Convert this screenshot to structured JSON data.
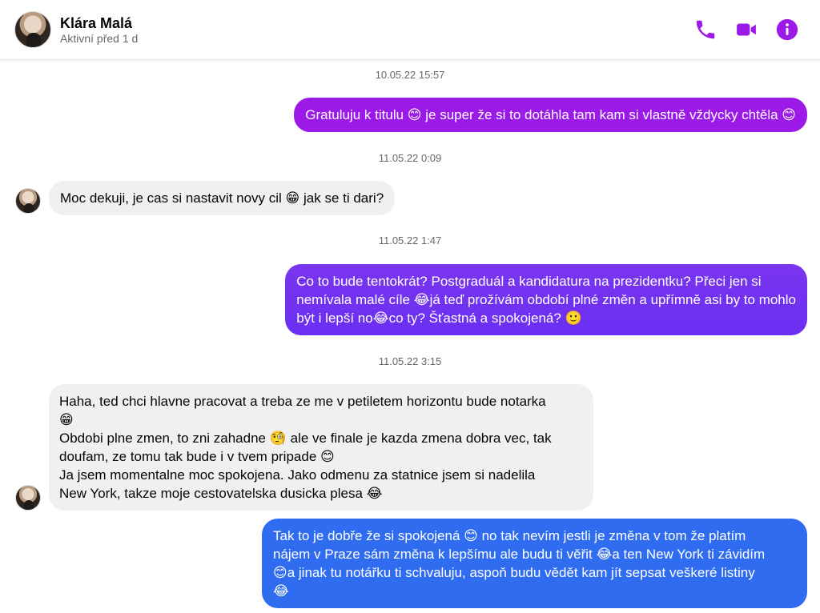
{
  "contact": {
    "name": "Klára Malá",
    "status": "Aktivní před 1 d"
  },
  "header_icons": [
    "phone-icon",
    "video-icon",
    "info-icon"
  ],
  "colors": {
    "accent": "#9b1ae8",
    "outgoing_1": "#9b1ae8",
    "outgoing_2": "#6a2ff2",
    "outgoing_3": "#2f6cf0",
    "incoming": "#f0f0f0"
  },
  "messages": [
    {
      "timestamp": "10.05.22 15:57"
    },
    {
      "direction": "outgoing",
      "lines": [
        "Gratuluju k titulu 😊 je super že si to dotáhla tam kam si vlastně vždycky chtěla 😊"
      ]
    },
    {
      "timestamp": "11.05.22 0:09"
    },
    {
      "direction": "incoming",
      "lines": [
        "Moc dekuji, je cas si nastavit novy cil 😁 jak se ti dari?"
      ]
    },
    {
      "timestamp": "11.05.22 1:47"
    },
    {
      "direction": "outgoing",
      "lines": [
        "Co to bude tentokrát? Postgraduál a kandidatura na prezidentku? Přeci jen si",
        "nemívala malé cíle 😂já teď  prožívám období plné změn a upřímně asi by to mohlo",
        "být i lepší no😂co ty? Šťastná a spokojená? 🙂"
      ]
    },
    {
      "timestamp": "11.05.22 3:15"
    },
    {
      "direction": "incoming",
      "lines": [
        "Haha, ted chci hlavne pracovat a treba ze me v petiletem horizontu bude notarka",
        "😁",
        "Obdobi plne zmen, to zni zahadne 🧐 ale ve finale je kazda zmena dobra vec, tak",
        "doufam, ze tomu tak bude i v tvem pripade 😊",
        "Ja jsem momentalne moc spokojena. Jako odmenu za statnice jsem si nadelila",
        "New York, takze moje cestovatelska dusicka plesa 😂"
      ]
    },
    {
      "direction": "outgoing",
      "lines": [
        "Tak to je dobře že si spokojená 😊 no tak nevím jestli je změna v tom že platím",
        "nájem v Praze sám změna k lepšímu ale budu ti věřit 😂a ten New York ti závidím",
        "😊a jinak tu notářku ti schvaluju, aspoň budu vědět kam jít sepsat veškeré listiny",
        "😂"
      ]
    }
  ]
}
